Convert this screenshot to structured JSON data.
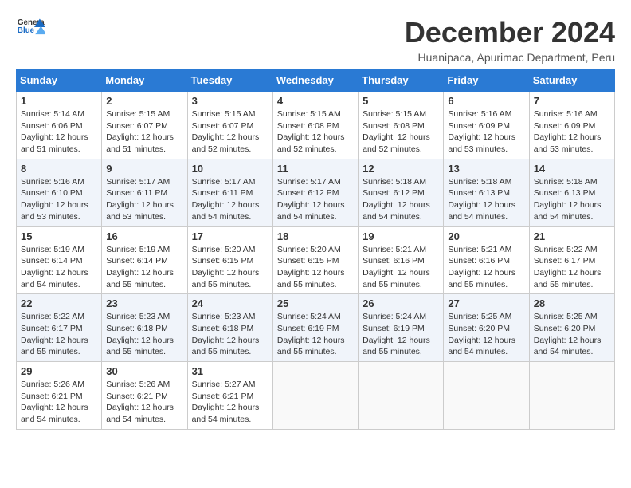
{
  "logo": {
    "line1": "General",
    "line2": "Blue"
  },
  "title": "December 2024",
  "location": "Huanipaca, Apurimac Department, Peru",
  "days_header": [
    "Sunday",
    "Monday",
    "Tuesday",
    "Wednesday",
    "Thursday",
    "Friday",
    "Saturday"
  ],
  "weeks": [
    {
      "shade": false,
      "days": [
        {
          "num": "1",
          "rise": "5:14 AM",
          "set": "6:06 PM",
          "daylight": "12 hours and 51 minutes."
        },
        {
          "num": "2",
          "rise": "5:15 AM",
          "set": "6:07 PM",
          "daylight": "12 hours and 51 minutes."
        },
        {
          "num": "3",
          "rise": "5:15 AM",
          "set": "6:07 PM",
          "daylight": "12 hours and 52 minutes."
        },
        {
          "num": "4",
          "rise": "5:15 AM",
          "set": "6:08 PM",
          "daylight": "12 hours and 52 minutes."
        },
        {
          "num": "5",
          "rise": "5:15 AM",
          "set": "6:08 PM",
          "daylight": "12 hours and 52 minutes."
        },
        {
          "num": "6",
          "rise": "5:16 AM",
          "set": "6:09 PM",
          "daylight": "12 hours and 53 minutes."
        },
        {
          "num": "7",
          "rise": "5:16 AM",
          "set": "6:09 PM",
          "daylight": "12 hours and 53 minutes."
        }
      ]
    },
    {
      "shade": true,
      "days": [
        {
          "num": "8",
          "rise": "5:16 AM",
          "set": "6:10 PM",
          "daylight": "12 hours and 53 minutes."
        },
        {
          "num": "9",
          "rise": "5:17 AM",
          "set": "6:11 PM",
          "daylight": "12 hours and 53 minutes."
        },
        {
          "num": "10",
          "rise": "5:17 AM",
          "set": "6:11 PM",
          "daylight": "12 hours and 54 minutes."
        },
        {
          "num": "11",
          "rise": "5:17 AM",
          "set": "6:12 PM",
          "daylight": "12 hours and 54 minutes."
        },
        {
          "num": "12",
          "rise": "5:18 AM",
          "set": "6:12 PM",
          "daylight": "12 hours and 54 minutes."
        },
        {
          "num": "13",
          "rise": "5:18 AM",
          "set": "6:13 PM",
          "daylight": "12 hours and 54 minutes."
        },
        {
          "num": "14",
          "rise": "5:18 AM",
          "set": "6:13 PM",
          "daylight": "12 hours and 54 minutes."
        }
      ]
    },
    {
      "shade": false,
      "days": [
        {
          "num": "15",
          "rise": "5:19 AM",
          "set": "6:14 PM",
          "daylight": "12 hours and 54 minutes."
        },
        {
          "num": "16",
          "rise": "5:19 AM",
          "set": "6:14 PM",
          "daylight": "12 hours and 55 minutes."
        },
        {
          "num": "17",
          "rise": "5:20 AM",
          "set": "6:15 PM",
          "daylight": "12 hours and 55 minutes."
        },
        {
          "num": "18",
          "rise": "5:20 AM",
          "set": "6:15 PM",
          "daylight": "12 hours and 55 minutes."
        },
        {
          "num": "19",
          "rise": "5:21 AM",
          "set": "6:16 PM",
          "daylight": "12 hours and 55 minutes."
        },
        {
          "num": "20",
          "rise": "5:21 AM",
          "set": "6:16 PM",
          "daylight": "12 hours and 55 minutes."
        },
        {
          "num": "21",
          "rise": "5:22 AM",
          "set": "6:17 PM",
          "daylight": "12 hours and 55 minutes."
        }
      ]
    },
    {
      "shade": true,
      "days": [
        {
          "num": "22",
          "rise": "5:22 AM",
          "set": "6:17 PM",
          "daylight": "12 hours and 55 minutes."
        },
        {
          "num": "23",
          "rise": "5:23 AM",
          "set": "6:18 PM",
          "daylight": "12 hours and 55 minutes."
        },
        {
          "num": "24",
          "rise": "5:23 AM",
          "set": "6:18 PM",
          "daylight": "12 hours and 55 minutes."
        },
        {
          "num": "25",
          "rise": "5:24 AM",
          "set": "6:19 PM",
          "daylight": "12 hours and 55 minutes."
        },
        {
          "num": "26",
          "rise": "5:24 AM",
          "set": "6:19 PM",
          "daylight": "12 hours and 55 minutes."
        },
        {
          "num": "27",
          "rise": "5:25 AM",
          "set": "6:20 PM",
          "daylight": "12 hours and 54 minutes."
        },
        {
          "num": "28",
          "rise": "5:25 AM",
          "set": "6:20 PM",
          "daylight": "12 hours and 54 minutes."
        }
      ]
    },
    {
      "shade": false,
      "days": [
        {
          "num": "29",
          "rise": "5:26 AM",
          "set": "6:21 PM",
          "daylight": "12 hours and 54 minutes."
        },
        {
          "num": "30",
          "rise": "5:26 AM",
          "set": "6:21 PM",
          "daylight": "12 hours and 54 minutes."
        },
        {
          "num": "31",
          "rise": "5:27 AM",
          "set": "6:21 PM",
          "daylight": "12 hours and 54 minutes."
        },
        null,
        null,
        null,
        null
      ]
    }
  ]
}
